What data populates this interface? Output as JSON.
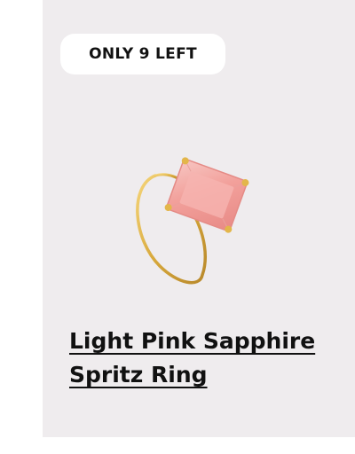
{
  "product": {
    "badge": "ONLY 9 LEFT",
    "title_line1": "Light Pink Sapphire",
    "title_line2": "Spritz Ring",
    "image_icon": "ring-image",
    "colors": {
      "card_background": "#efecee",
      "badge_background": "#ffffff",
      "band": "#e0b64a",
      "stone": "#f2a7a3"
    }
  }
}
